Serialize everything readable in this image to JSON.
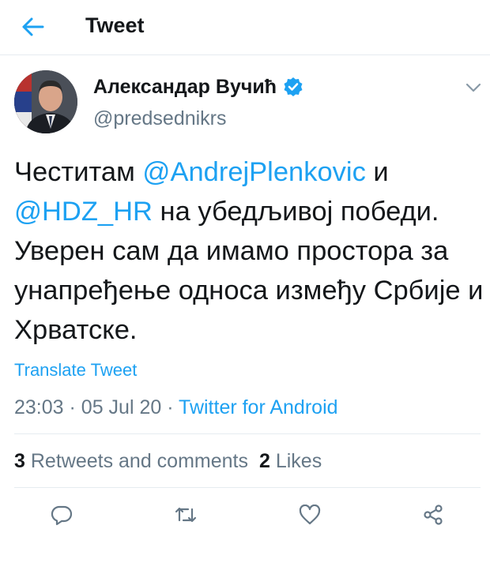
{
  "header": {
    "title": "Tweet",
    "back_icon": "arrow-left-icon"
  },
  "author": {
    "display_name": "Александар Вучић",
    "handle": "@predsednikrs",
    "verified_icon": "verified-badge-icon"
  },
  "tweet": {
    "text_1": "Честитам ",
    "mention_1": "@AndrejPlenkovic",
    "text_2": " и",
    "mention_2": "@HDZ_HR",
    "text_3": " на убедљивој победи. Уверен сам да имамо простора за унапређење односа између Србије и Хрватске."
  },
  "translate_label": "Translate Tweet",
  "meta": {
    "time": "23:03",
    "separator": "·",
    "date": "05 Jul 20",
    "source": "Twitter for Android"
  },
  "stats": {
    "retweets_count": "3",
    "retweets_label": "Retweets and comments",
    "likes_count": "2",
    "likes_label": "Likes"
  },
  "actions": [
    "reply-icon",
    "retweet-icon",
    "like-icon",
    "share-icon"
  ],
  "colors": {
    "accent": "#1da1f2",
    "text": "#14171a",
    "secondary": "#657786",
    "divider": "#e6ecf0"
  }
}
